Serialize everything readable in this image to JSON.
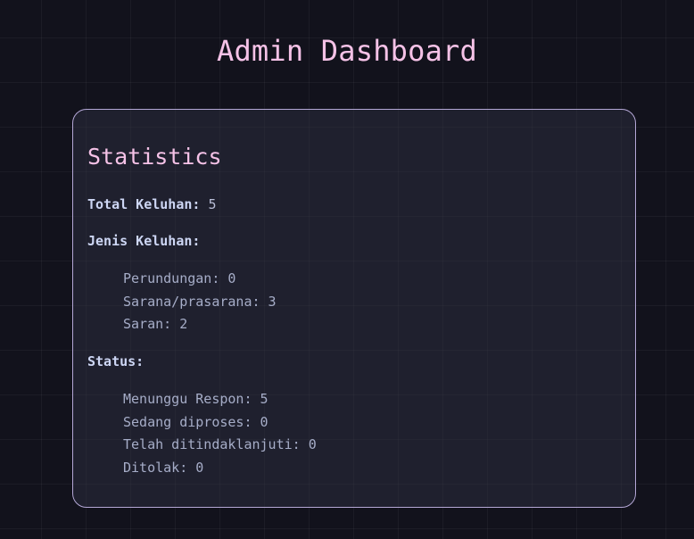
{
  "header": {
    "title": "Admin Dashboard"
  },
  "statistics": {
    "heading": "Statistics",
    "total": {
      "label": "Total Keluhan:",
      "value": "5"
    },
    "jenis": {
      "label": "Jenis Keluhan:",
      "items": [
        "Perundungan: 0",
        "Sarana/prasarana: 3",
        "Saran: 2"
      ]
    },
    "status": {
      "label": "Status:",
      "items": [
        "Menunggu Respon: 5",
        "Sedang diproses: 0",
        "Telah ditindaklanjuti: 0",
        "Ditolak: 0"
      ]
    }
  },
  "colors": {
    "background": "#12121c",
    "accent": "#f5c2e7",
    "card_border": "#b4a7d6",
    "text": "#cdd6f4",
    "muted_text": "#a6adc8"
  }
}
